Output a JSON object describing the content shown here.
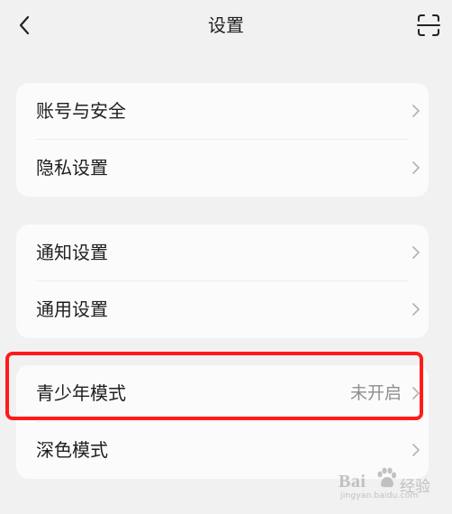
{
  "header": {
    "title": "设置",
    "back_icon": "chevron-left-icon",
    "scan_icon": "scan-icon"
  },
  "groups": [
    {
      "items": [
        {
          "label": "账号与安全",
          "value": ""
        },
        {
          "label": "隐私设置",
          "value": ""
        }
      ]
    },
    {
      "items": [
        {
          "label": "通知设置",
          "value": ""
        },
        {
          "label": "通用设置",
          "value": ""
        }
      ]
    },
    {
      "items": [
        {
          "label": "青少年模式",
          "value": "未开启"
        },
        {
          "label": "深色模式",
          "value": ""
        }
      ]
    }
  ],
  "annotation": {
    "highlight_color": "#ff1b1b"
  },
  "watermark": {
    "logo_text": "Bai",
    "suffix": "经验",
    "url": "jingyan.baidu.com"
  },
  "colors": {
    "background": "#f1f1f1",
    "card": "#fbfbfb",
    "secondary_text": "#8f8f8f"
  }
}
